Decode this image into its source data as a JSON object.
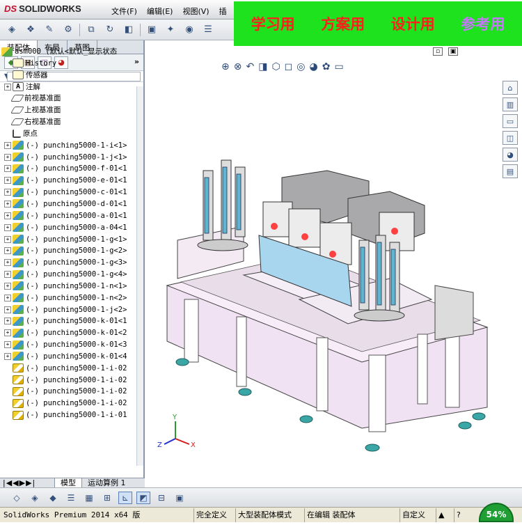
{
  "app": {
    "logo_prefix": "DS",
    "logo_text": "SOLIDWORKS"
  },
  "menu": [
    "文件(F)",
    "编辑(E)",
    "视图(V)",
    "插"
  ],
  "banner": {
    "items": [
      "学习用",
      "方案用",
      "设计用",
      "参考用"
    ],
    "color_main": "#ff1d1d",
    "color_last": "#c874ff",
    "background": "#1de21d"
  },
  "panel_tabs": [
    "装配体",
    "布局",
    "草图"
  ],
  "tree": {
    "root": "asm000  (默认<默认_显示状态",
    "fixed_items": [
      {
        "label": "History",
        "icon": "history-icon"
      },
      {
        "label": "传感器",
        "icon": "sensor-icon"
      },
      {
        "label": "注解",
        "icon": "annotation-icon"
      },
      {
        "label": "前视基准面",
        "icon": "plane-icon"
      },
      {
        "label": "上视基准面",
        "icon": "plane-icon"
      },
      {
        "label": "右视基准面",
        "icon": "plane-icon"
      },
      {
        "label": "原点",
        "icon": "origin-icon"
      }
    ],
    "parts": [
      "(-) punching5000-1-i<1>",
      "(-) punching5000-1-j<1>",
      "(-) punching5000-f-01<1",
      "(-) punching5000-e-01<1",
      "(-) punching5000-c-01<1",
      "(-) punching5000-d-01<1",
      "(-) punching5000-a-01<1",
      "(-) punching5000-a-04<1",
      "(-) punching5000-1-g<1>",
      "(-) punching5000-1-g<2>",
      "(-) punching5000-1-g<3>",
      "(-) punching5000-1-g<4>",
      "(-) punching5000-1-n<1>",
      "(-) punching5000-1-n<2>",
      "(-) punching5000-1-j<2>",
      "(-) punching5000-k-01<1",
      "(-) punching5000-k-01<2",
      "(-) punching5000-k-01<3",
      "(-) punching5000-k-01<4",
      "(-) punching5000-1-i-02",
      "(-) punching5000-1-i-02",
      "(-) punching5000-1-i-02",
      "(-) punching5000-1-i-02",
      "(-) punching5000-1-i-01"
    ]
  },
  "bottom_tabs": [
    "模型",
    "运动算例 1"
  ],
  "status": {
    "product": "SolidWorks Premium 2014 x64 版",
    "state1": "完全定义",
    "state2": "大型装配体模式",
    "state3": "在编辑 装配体",
    "state4": "自定义",
    "progress": "54%"
  },
  "axis": {
    "x": "X",
    "y": "Y",
    "z": "Z"
  }
}
